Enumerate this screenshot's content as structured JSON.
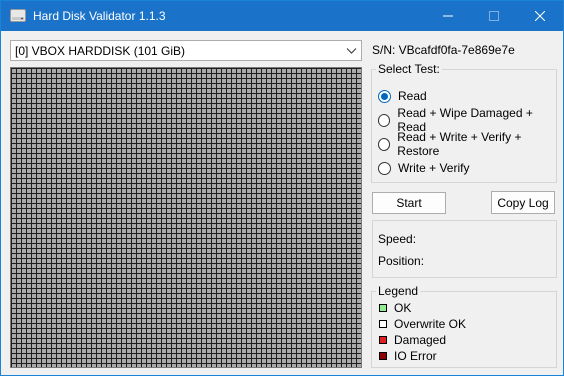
{
  "window": {
    "title": "Hard Disk Validator 1.1.3",
    "accent": "#1a73c9"
  },
  "disk": {
    "selected": "[0] VBOX HARDDISK (101 GiB)",
    "serial": "S/N: VBcafdf0fa-7e869e7e"
  },
  "block_map": {
    "fill_color": "#a9a9a9",
    "grid_line_color": "#1e1e1e"
  },
  "test": {
    "group_label": "Select Test:",
    "options": [
      {
        "label": "Read",
        "selected": true
      },
      {
        "label": "Read + Wipe Damaged + Read",
        "selected": false
      },
      {
        "label": "Read + Write + Verify + Restore",
        "selected": false
      },
      {
        "label": "Write + Verify",
        "selected": false
      }
    ]
  },
  "actions": {
    "start_label": "Start",
    "copy_log_label": "Copy Log"
  },
  "status": {
    "speed_label": "Speed:",
    "position_label": "Position:"
  },
  "legend": {
    "title": "Legend",
    "items": [
      {
        "label": "OK",
        "color": "#90ee90"
      },
      {
        "label": "Overwrite OK",
        "color": "#ffffff"
      },
      {
        "label": "Damaged",
        "color": "#e02020"
      },
      {
        "label": "IO Error",
        "color": "#8b0000"
      }
    ]
  }
}
